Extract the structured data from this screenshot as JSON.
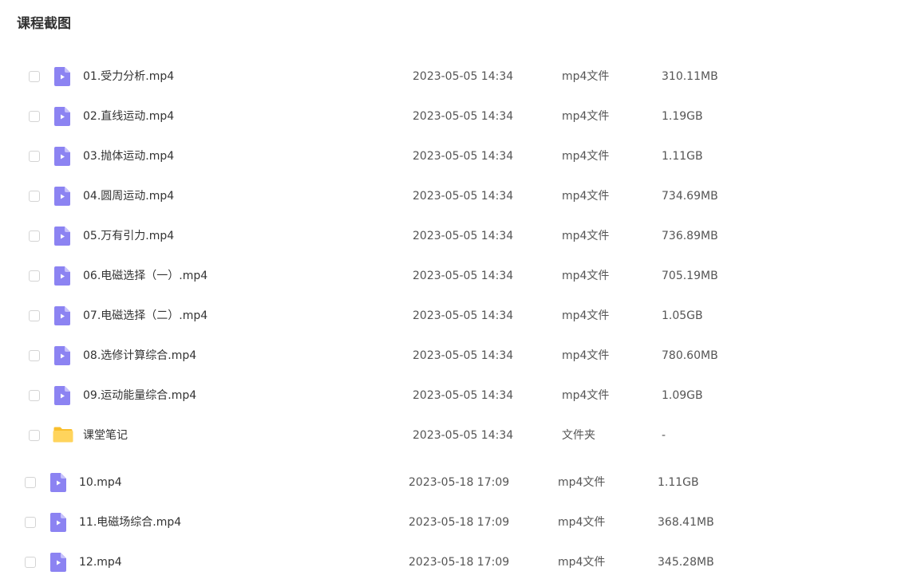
{
  "page": {
    "title": "课程截图"
  },
  "colors": {
    "video_icon": "#8c83f2",
    "video_icon_fold": "#c6c1fb",
    "folder_icon": "#ffd45c",
    "folder_tab": "#f9bf2d"
  },
  "files": [
    {
      "name": "01.受力分析.mp4",
      "date": "2023-05-05 14:34",
      "type": "mp4文件",
      "size": "310.11MB",
      "icon": "video-file-icon"
    },
    {
      "name": "02.直线运动.mp4",
      "date": "2023-05-05 14:34",
      "type": "mp4文件",
      "size": "1.19GB",
      "icon": "video-file-icon"
    },
    {
      "name": "03.抛体运动.mp4",
      "date": "2023-05-05 14:34",
      "type": "mp4文件",
      "size": "1.11GB",
      "icon": "video-file-icon"
    },
    {
      "name": "04.圆周运动.mp4",
      "date": "2023-05-05 14:34",
      "type": "mp4文件",
      "size": "734.69MB",
      "icon": "video-file-icon"
    },
    {
      "name": "05.万有引力.mp4",
      "date": "2023-05-05 14:34",
      "type": "mp4文件",
      "size": "736.89MB",
      "icon": "video-file-icon"
    },
    {
      "name": "06.电磁选择（一）.mp4",
      "date": "2023-05-05 14:34",
      "type": "mp4文件",
      "size": "705.19MB",
      "icon": "video-file-icon"
    },
    {
      "name": "07.电磁选择（二）.mp4",
      "date": "2023-05-05 14:34",
      "type": "mp4文件",
      "size": "1.05GB",
      "icon": "video-file-icon"
    },
    {
      "name": "08.选修计算综合.mp4",
      "date": "2023-05-05 14:34",
      "type": "mp4文件",
      "size": "780.60MB",
      "icon": "video-file-icon"
    },
    {
      "name": "09.运动能量综合.mp4",
      "date": "2023-05-05 14:34",
      "type": "mp4文件",
      "size": "1.09GB",
      "icon": "video-file-icon"
    },
    {
      "name": "课堂笔记",
      "date": "2023-05-05 14:34",
      "type": "文件夹",
      "size": "-",
      "icon": "folder-icon"
    },
    {
      "name": "10.mp4",
      "date": "2023-05-18 17:09",
      "type": "mp4文件",
      "size": "1.11GB",
      "icon": "video-file-icon"
    },
    {
      "name": "11.电磁场综合.mp4",
      "date": "2023-05-18 17:09",
      "type": "mp4文件",
      "size": "368.41MB",
      "icon": "video-file-icon"
    },
    {
      "name": "12.mp4",
      "date": "2023-05-18 17:09",
      "type": "mp4文件",
      "size": "345.28MB",
      "icon": "video-file-icon"
    }
  ]
}
